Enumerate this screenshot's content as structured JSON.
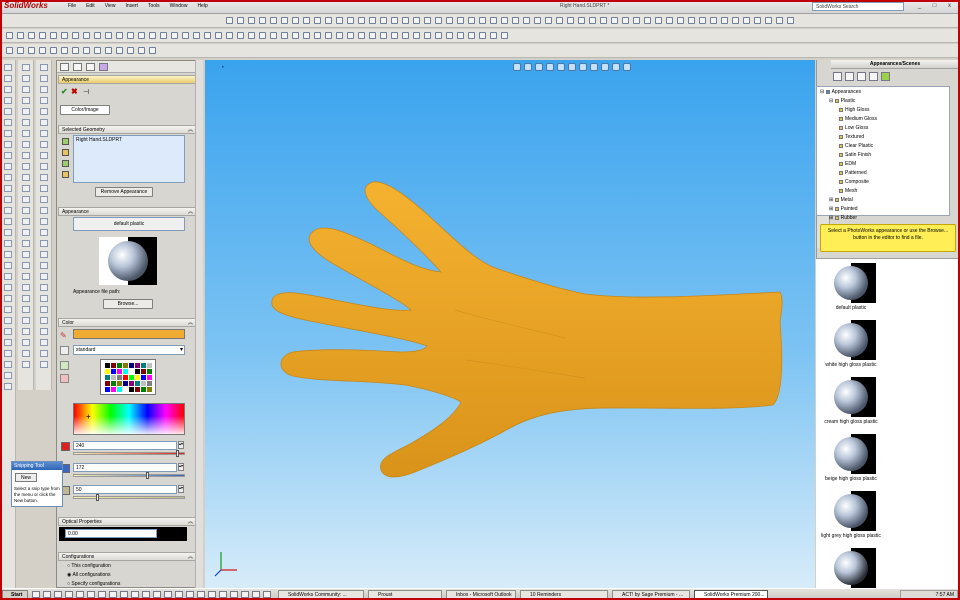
{
  "app": {
    "logo": "SolidWorks",
    "title": "Right Hand.SLDPRT *",
    "menu": [
      "File",
      "Edit",
      "View",
      "Insert",
      "Tools",
      "Window",
      "Help"
    ],
    "search_placeholder": "SolidWorks Search",
    "win_controls": [
      "_",
      "□",
      "x"
    ]
  },
  "property_manager": {
    "title": "Appearance",
    "tab_label": "Color/Image",
    "selected_geometry": {
      "label": "Selected Geometry",
      "item": "Right Hand.SLDPRT",
      "remove_button": "Remove Appearance"
    },
    "appearance": {
      "label": "Appearance",
      "name": "default plastic",
      "file_path_label": "Appearance file path:",
      "browse_button": "Browse..."
    },
    "color": {
      "label": "Color",
      "swatch_color": "#f0ac32",
      "palette": "standard",
      "sliders": [
        {
          "value": "240",
          "track_color": "#e02020",
          "fraction": 0.94
        },
        {
          "value": "172",
          "track_color": "#3a66c2",
          "fraction": 0.67
        },
        {
          "value": "50",
          "track_color": "#c0b890",
          "fraction": 0.2
        }
      ]
    },
    "optical": {
      "label": "Optical Properties",
      "value": "0.00"
    },
    "configurations": {
      "label": "Configurations",
      "options": [
        "This configuration",
        "All configurations",
        "Specify configurations"
      ]
    }
  },
  "snipping_tool": {
    "title": "Snipping Tool",
    "new_button": "New",
    "hint": "Select a snip type from the menu or click the New button."
  },
  "task_pane": {
    "header": "Appearances/Scenes",
    "tree": {
      "root": "Appearances",
      "group": "Plastic",
      "items": [
        "High Gloss",
        "Medium Gloss",
        "Low Gloss",
        "Textured",
        "Clear Plastic",
        "Satin Finish",
        "EDM",
        "Patterned",
        "Composite",
        "Mesh"
      ],
      "siblings": [
        "Metal",
        "Painted",
        "Rubber"
      ]
    },
    "notice": "Select a PhotoWorks appearance or use the Browse... button in the editor to find a file.",
    "gallery": [
      "default plastic",
      "white high gloss plastic",
      "cream high gloss plastic",
      "beige high gloss plastic",
      "light grey high gloss plastic",
      ""
    ]
  },
  "model": {
    "color": "#f5b230",
    "shade": "#d9931a"
  },
  "taskbar": {
    "start": "Start",
    "tasks": [
      "SolidWorks Community: ...",
      "Proust",
      "Inbox - Microsoft Outlook",
      "10 Reminders",
      "ACT! by Sage Premium - ...",
      "SolidWorks Premium 200..."
    ],
    "clock": "7:57 AM"
  }
}
